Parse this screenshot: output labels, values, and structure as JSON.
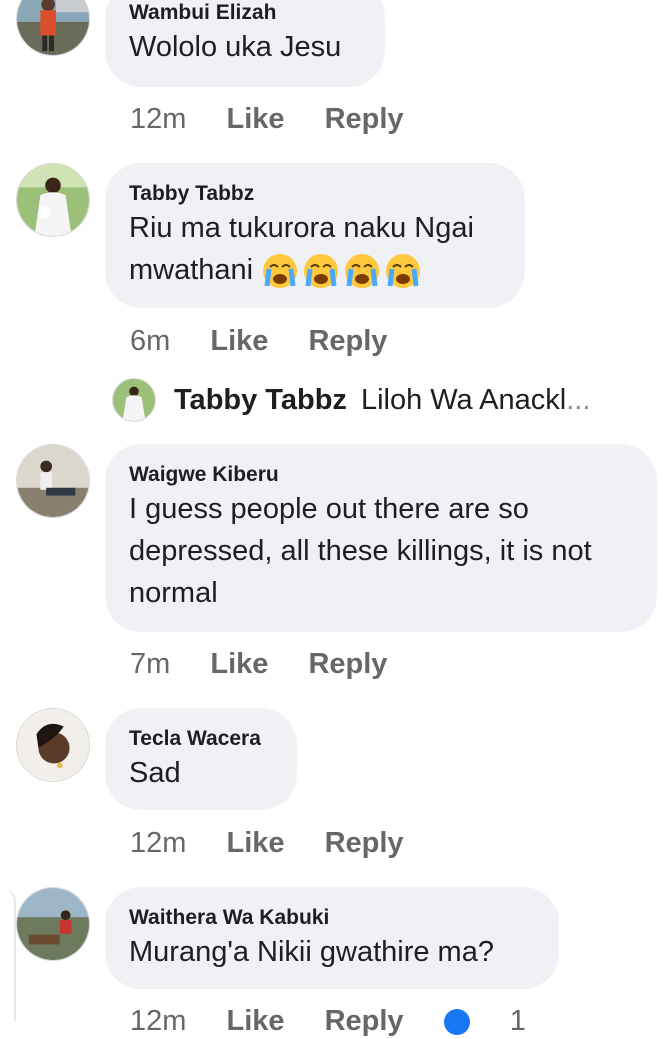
{
  "comments": [
    {
      "author": "Wambui Elizah",
      "text": "Wololo uka Jesu",
      "time": "12m",
      "like": "Like",
      "reply": "Reply"
    },
    {
      "author": "Tabby Tabbz",
      "text": "Riu ma tukurora naku Ngai mwathani",
      "emoji": "loudly-crying-face x4",
      "time": "6m",
      "like": "Like",
      "reply": "Reply"
    },
    {
      "author": "Waigwe Kiberu",
      "text": "I guess people out there are so depressed, all these killings, it is not normal",
      "time": "7m",
      "like": "Like",
      "reply": "Reply"
    },
    {
      "author": "Tecla Wacera",
      "text": "Sad",
      "time": "12m",
      "like": "Like",
      "reply": "Reply"
    },
    {
      "author": "Waithera Wa Kabuki",
      "text": "Murang'a Nikii gwathire ma?",
      "time": "12m",
      "like": "Like",
      "reply": "Reply",
      "reaction_count": "1"
    }
  ],
  "reply_preview": {
    "author": "Tabby Tabbz",
    "text": "Liloh Wa Anackl",
    "ellipsis": "..."
  },
  "colors": {
    "bubble": "#f0f1f4",
    "text": "#1c1e21",
    "meta": "#65676b",
    "accent": "#1877f2"
  }
}
